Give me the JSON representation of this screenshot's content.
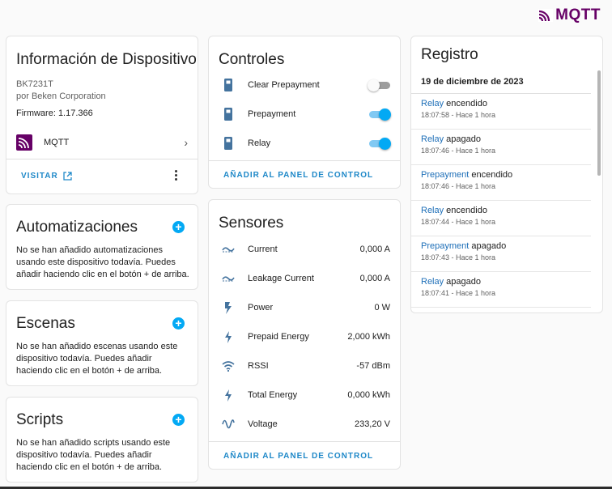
{
  "brand": {
    "name": "MQTT",
    "color": "#660066"
  },
  "device_info": {
    "title": "Información de Dispositivo",
    "model": "BK7231T",
    "manufacturer": "por Beken Corporation",
    "firmware": "Firmware: 1.17.366",
    "integration": "MQTT",
    "visit_label": "VISITAR"
  },
  "automations": {
    "title": "Automatizaciones",
    "text": "No se han añadido automatizaciones usando este dispositivo todavía. Puedes añadir haciendo clic en el botón + de arriba."
  },
  "scenes": {
    "title": "Escenas",
    "text": "No se han añadido escenas usando este dispositivo todavía. Puedes añadir haciendo clic en el botón + de arriba."
  },
  "scripts": {
    "title": "Scripts",
    "text": "No se han añadido scripts usando este dispositivo todavía. Puedes añadir haciendo clic en el botón + de arriba."
  },
  "controls": {
    "title": "Controles",
    "items": [
      {
        "name": "Clear Prepayment",
        "state": "off"
      },
      {
        "name": "Prepayment",
        "state": "on"
      },
      {
        "name": "Relay",
        "state": "on"
      }
    ],
    "add_to_dashboard": "AÑADIR AL PANEL DE CONTROL"
  },
  "sensors": {
    "title": "Sensores",
    "items": [
      {
        "name": "Current",
        "value": "0,000 A",
        "icon": "current-ac-icon"
      },
      {
        "name": "Leakage Current",
        "value": "0,000 A",
        "icon": "current-ac-icon"
      },
      {
        "name": "Power",
        "value": "0 W",
        "icon": "flash-icon"
      },
      {
        "name": "Prepaid Energy",
        "value": "2,000 kWh",
        "icon": "lightning-icon"
      },
      {
        "name": "RSSI",
        "value": "-57 dBm",
        "icon": "wifi-icon"
      },
      {
        "name": "Total Energy",
        "value": "0,000 kWh",
        "icon": "lightning-icon"
      },
      {
        "name": "Voltage",
        "value": "233,20 V",
        "icon": "sine-wave-icon"
      }
    ],
    "add_to_dashboard": "AÑADIR AL PANEL DE CONTROL"
  },
  "logbook": {
    "title": "Registro",
    "date": "19 de diciembre de 2023",
    "entries": [
      {
        "entity": "Relay",
        "action": " encendido",
        "time": "18:07:58 - Hace 1 hora"
      },
      {
        "entity": "Relay",
        "action": " apagado",
        "time": "18:07:46 - Hace 1 hora"
      },
      {
        "entity": "Prepayment",
        "action": " encendido",
        "time": "18:07:46 - Hace 1 hora"
      },
      {
        "entity": "Relay",
        "action": " encendido",
        "time": "18:07:44 - Hace 1 hora"
      },
      {
        "entity": "Prepayment",
        "action": " apagado",
        "time": "18:07:43 - Hace 1 hora"
      },
      {
        "entity": "Relay",
        "action": " apagado",
        "time": "18:07:41 - Hace 1 hora"
      }
    ]
  },
  "colors": {
    "accent": "#03a9f4",
    "link": "#1e88c8",
    "entity_icon": "#44739e"
  }
}
